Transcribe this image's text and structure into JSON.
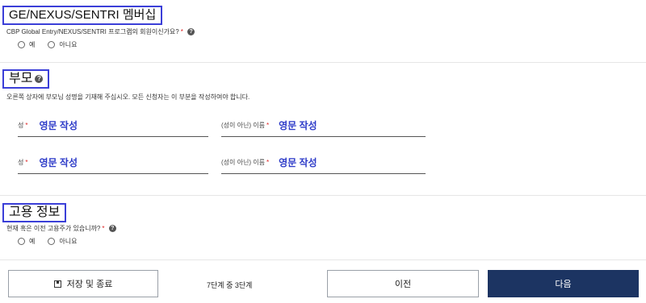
{
  "membership": {
    "title": "GE/NEXUS/SENTRI 멤버십",
    "question": "CBP Global Entry/NEXUS/SENTRI 프로그램의 회원이신가요?",
    "required_mark": "*",
    "options": [
      "예",
      "아니요"
    ]
  },
  "parents": {
    "title": "부모",
    "description": "오른쪽 상자에 부모님 성명을 기재해 주십시오. 모든 신청자는 이 부분을 작성하여야 합니다.",
    "rows": [
      {
        "surname_label": "성",
        "surname_value": "영문 작성",
        "given_label": "(성이 아닌) 이름",
        "given_value": "영문 작성"
      },
      {
        "surname_label": "성",
        "surname_value": "영문 작성",
        "given_label": "(성이 아닌) 이름",
        "given_value": "영문 작성"
      }
    ],
    "required_mark": "*"
  },
  "employment": {
    "title": "고용 정보",
    "question": "현재 혹은 이전 고용주가 있습니까?",
    "required_mark": "*",
    "options": [
      "예",
      "아니요"
    ]
  },
  "footer": {
    "save_label": "저장 및 종료",
    "step_text": "7단계 중 3단계",
    "prev_label": "이전",
    "next_label": "다음"
  },
  "icons": {
    "help": "help-circle-icon",
    "save": "save-icon"
  },
  "colors": {
    "highlight_border": "#3b3fd8",
    "field_value": "#2c3ac8",
    "primary_button": "#1c3462",
    "required": "#dd2222"
  }
}
